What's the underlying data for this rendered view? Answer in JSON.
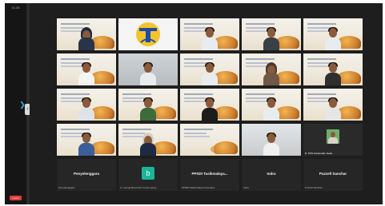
{
  "sidebar": {
    "time": "01:35",
    "leave_label": "Leave"
  },
  "grid": {
    "row1": [
      {
        "name": "",
        "kind": "slide-person"
      },
      {
        "name": "",
        "kind": "logo"
      },
      {
        "name": "",
        "kind": "slide-person"
      },
      {
        "name": "",
        "kind": "slide-person"
      },
      {
        "name": "",
        "kind": "slide-person"
      }
    ],
    "row5_tiles": [
      {
        "label": "Penyelenggara",
        "caption": "Penyelenggara"
      },
      {
        "label": "b",
        "caption": "b, Lounge Baru Kab. Kudus (prog..."
      },
      {
        "label": "PPSDI Tasikmalaya...",
        "caption": "PPSDI Tasikmalaya Kemenkes"
      },
      {
        "label": "Indra",
        "caption": "Indra"
      },
      {
        "label": "Puzzell Sanchar",
        "caption": "Puzzell Sanchar"
      }
    ],
    "row4_captions": {
      "tile5": "D. PUS Kecamatan Gadu..."
    }
  },
  "colors": {
    "background": "#1a1a1a",
    "leave": "#e03a3a",
    "accent": "#3fa9f5",
    "avatar_b": "#19b69a"
  }
}
